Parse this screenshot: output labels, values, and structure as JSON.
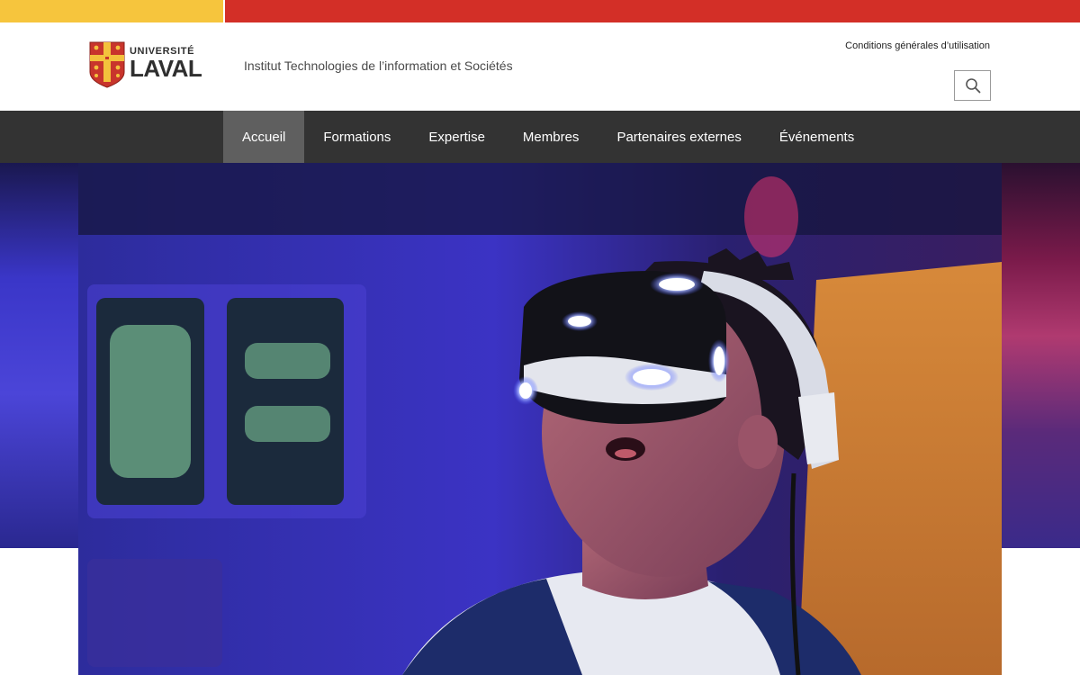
{
  "brand": {
    "logo_line1": "UNIVERSITÉ",
    "logo_line2": "LAVAL",
    "institute_name": "Institut Technologies de l’information et Sociétés",
    "colors": {
      "yellow": "#f6c53d",
      "red": "#d32f27",
      "nav_bg": "#333333",
      "nav_active": "#5f5f5f"
    }
  },
  "header": {
    "terms_link": "Conditions générales d’utilisation",
    "search_icon": "search-icon"
  },
  "nav": {
    "items": [
      {
        "label": "Accueil",
        "active": true
      },
      {
        "label": "Formations",
        "active": false
      },
      {
        "label": "Expertise",
        "active": false
      },
      {
        "label": "Membres",
        "active": false
      },
      {
        "label": "Partenaires externes",
        "active": false
      },
      {
        "label": "Événements",
        "active": false
      }
    ]
  }
}
